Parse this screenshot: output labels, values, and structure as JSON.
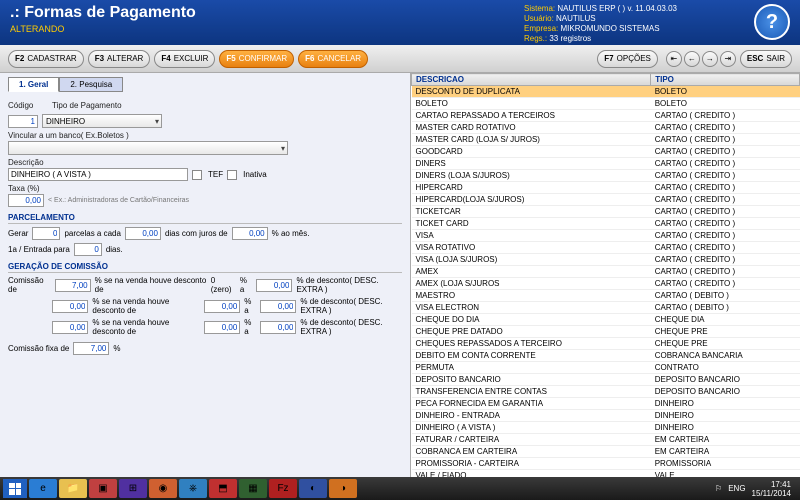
{
  "header": {
    "title": ".: Formas de Pagamento",
    "subtitle": "ALTERANDO",
    "sistema_lbl": "Sistema:",
    "sistema_val": "NAUTILUS ERP ( )  v. 11.04.03.03",
    "usuario_lbl": "Usuário:",
    "usuario_val": "NAUTILUS",
    "empresa_lbl": "Empresa:",
    "empresa_val": "MIKROMUNDO SISTEMAS",
    "regs_lbl": "Regs.:",
    "regs_val": "33 registros"
  },
  "toolbar": {
    "cadastrar": {
      "key": "F2",
      "label": "CADASTRAR"
    },
    "alterar": {
      "key": "F3",
      "label": "ALTERAR"
    },
    "excluir": {
      "key": "F4",
      "label": "EXCLUIR"
    },
    "confirmar": {
      "key": "F5",
      "label": "CONFIRMAR"
    },
    "cancelar": {
      "key": "F6",
      "label": "CANCELAR"
    },
    "opcoes": {
      "key": "F7",
      "label": "OPÇÕES"
    },
    "sair": {
      "key": "ESC",
      "label": "SAIR"
    }
  },
  "tabs": {
    "geral": "1. Geral",
    "pesquisa": "2. Pesquisa"
  },
  "form": {
    "codigo_lbl": "Código",
    "codigo": "1",
    "tipo_lbl": "Tipo de Pagamento",
    "tipo": "DINHEIRO",
    "vincular_lbl": "Vincular a um banco( Ex.Boletos )",
    "vincular": "",
    "descricao_lbl": "Descrição",
    "descricao": "DINHEIRO ( A VISTA )",
    "tef_lbl": "TEF",
    "inativa_lbl": "Inativa",
    "taxa_lbl": "Taxa (%)",
    "taxa": "0,00",
    "taxa_hint": "< Ex.: Administradoras de Cartão/Financeiras",
    "parcelamento": "PARCELAMENTO",
    "gerar_lbl": "Gerar",
    "gerar": "0",
    "gerar_suf": "parcelas a cada",
    "cada": "0,00",
    "cada_suf": "dias com juros de",
    "juros": "0,00",
    "juros_suf": "% ao mês.",
    "entrada_lbl": "1a / Entrada para",
    "entrada": "0",
    "entrada_suf": "dias.",
    "comissao_hdr": "GERAÇÃO DE COMISSÃO",
    "com_lbl": "Comissão de",
    "c1": "7,00",
    "cfix_lbl": "Comissão fixa de",
    "cfix": "7,00",
    "c_r1_a": "% se na venda houve desconto de",
    "c_zero": "0 (zero)",
    "c_r1_b": "%  a",
    "c_r1_c": "0,00",
    "c_r1_d": "%  de desconto( DESC. EXTRA )",
    "c2": "0,00",
    "c2b": "0,00",
    "c2c": "0,00",
    "c3": "0,00",
    "c3b": "0,00",
    "c3c": "0,00",
    "c_rn_a": "% se na venda houve desconto de",
    "c_rn_b": "%  a",
    "c_rn_d": "%  de desconto( DESC. EXTRA )",
    "pct": "%"
  },
  "grid": {
    "col1": "DESCRICAO",
    "col2": "TIPO",
    "rows": [
      {
        "d": "DESCONTO DE DUPLICATA",
        "t": "BOLETO"
      },
      {
        "d": "BOLETO",
        "t": "BOLETO"
      },
      {
        "d": "CARTAO REPASSADO A TERCEIROS",
        "t": "CARTAO ( CREDITO )"
      },
      {
        "d": "MASTER CARD ROTATIVO",
        "t": "CARTAO ( CREDITO )"
      },
      {
        "d": "MASTER CARD (LOJA S/ JUROS)",
        "t": "CARTAO ( CREDITO )"
      },
      {
        "d": "GOODCARD",
        "t": "CARTAO ( CREDITO )"
      },
      {
        "d": "DINERS",
        "t": "CARTAO ( CREDITO )"
      },
      {
        "d": "DINERS (LOJA S/JUROS)",
        "t": "CARTAO ( CREDITO )"
      },
      {
        "d": "HIPERCARD",
        "t": "CARTAO ( CREDITO )"
      },
      {
        "d": "HIPERCARD(LOJA S/JUROS)",
        "t": "CARTAO ( CREDITO )"
      },
      {
        "d": "TICKETCAR",
        "t": "CARTAO ( CREDITO )"
      },
      {
        "d": "TICKET CARD",
        "t": "CARTAO ( CREDITO )"
      },
      {
        "d": "VISA",
        "t": "CARTAO ( CREDITO )"
      },
      {
        "d": "VISA ROTATIVO",
        "t": "CARTAO ( CREDITO )"
      },
      {
        "d": "VISA (LOJA S/JUROS)",
        "t": "CARTAO ( CREDITO )"
      },
      {
        "d": "AMEX",
        "t": "CARTAO ( CREDITO )"
      },
      {
        "d": "AMEX (LOJA S/JUROS",
        "t": "CARTAO ( CREDITO )"
      },
      {
        "d": "MAESTRO",
        "t": "CARTAO ( DEBITO )"
      },
      {
        "d": "VISA ELECTRON",
        "t": "CARTAO ( DEBITO )"
      },
      {
        "d": "CHEQUE DO DIA",
        "t": "CHEQUE DIA"
      },
      {
        "d": "CHEQUE PRE DATADO",
        "t": "CHEQUE PRE"
      },
      {
        "d": "CHEQUES REPASSADOS A TERCEIRO",
        "t": "CHEQUE PRE"
      },
      {
        "d": "DEBITO EM CONTA CORRENTE",
        "t": "COBRANCA BANCARIA"
      },
      {
        "d": "PERMUTA",
        "t": "CONTRATO"
      },
      {
        "d": "DEPOSITO BANCARIO",
        "t": "DEPOSITO BANCARIO"
      },
      {
        "d": "TRANSFERENCIA ENTRE CONTAS",
        "t": "DEPOSITO BANCARIO"
      },
      {
        "d": "PECA FORNECIDA EM GARANTIA",
        "t": "DINHEIRO"
      },
      {
        "d": "DINHEIRO - ENTRADA",
        "t": "DINHEIRO"
      },
      {
        "d": "DINHEIRO ( A VISTA )",
        "t": "DINHEIRO"
      },
      {
        "d": "FATURAR / CARTEIRA",
        "t": "EM CARTEIRA"
      },
      {
        "d": "COBRANCA EM CARTEIRA",
        "t": "EM CARTEIRA"
      },
      {
        "d": "PROMISSORIA - CARTEIRA",
        "t": "PROMISSORIA"
      },
      {
        "d": "VALE / FIADO",
        "t": "VALE"
      }
    ]
  },
  "tray": {
    "flag": "⚐",
    "lang": "ENG",
    "time": "17:41",
    "date": "15/11/2014"
  }
}
